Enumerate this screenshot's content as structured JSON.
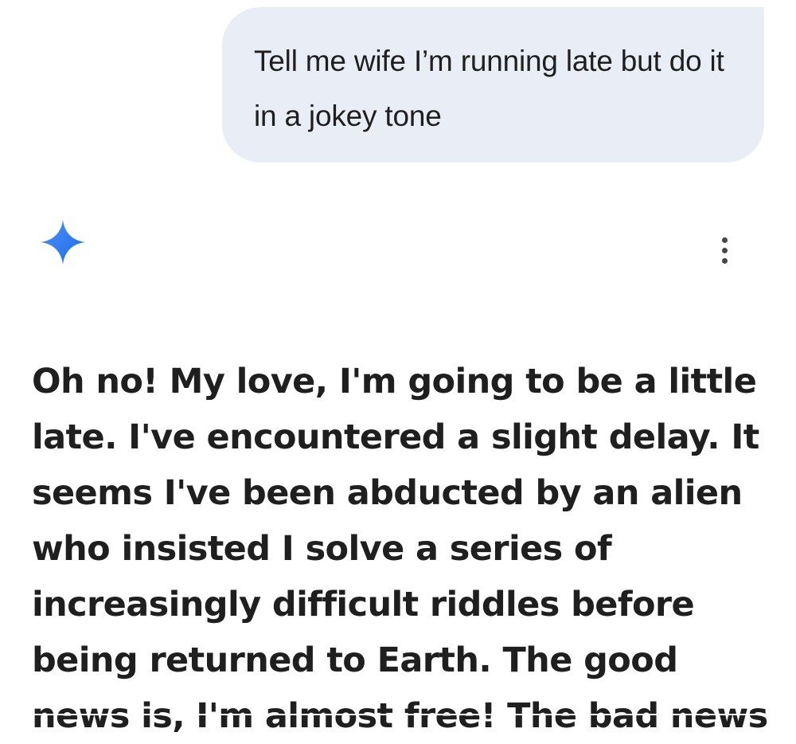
{
  "user_message": {
    "text": "Tell me wife I’m running late but do it in a jokey tone"
  },
  "assistant": {
    "avatar_icon": "gemini-spark-icon",
    "menu_icon": "more-vert-icon",
    "response_text": "Oh no! My love, I'm going to be a little late. I've encountered a slight delay. It seems I've been abducted by an alien who insisted I solve a series of increasingly difficult riddles before being returned to Earth. The good news is, I'm almost free! The bad news"
  },
  "colors": {
    "bubble_bg": "#e9eef6",
    "text": "#1f1f1f",
    "spark_start": "#4285f4",
    "spark_end": "#1a73e8",
    "icon": "#444746"
  }
}
